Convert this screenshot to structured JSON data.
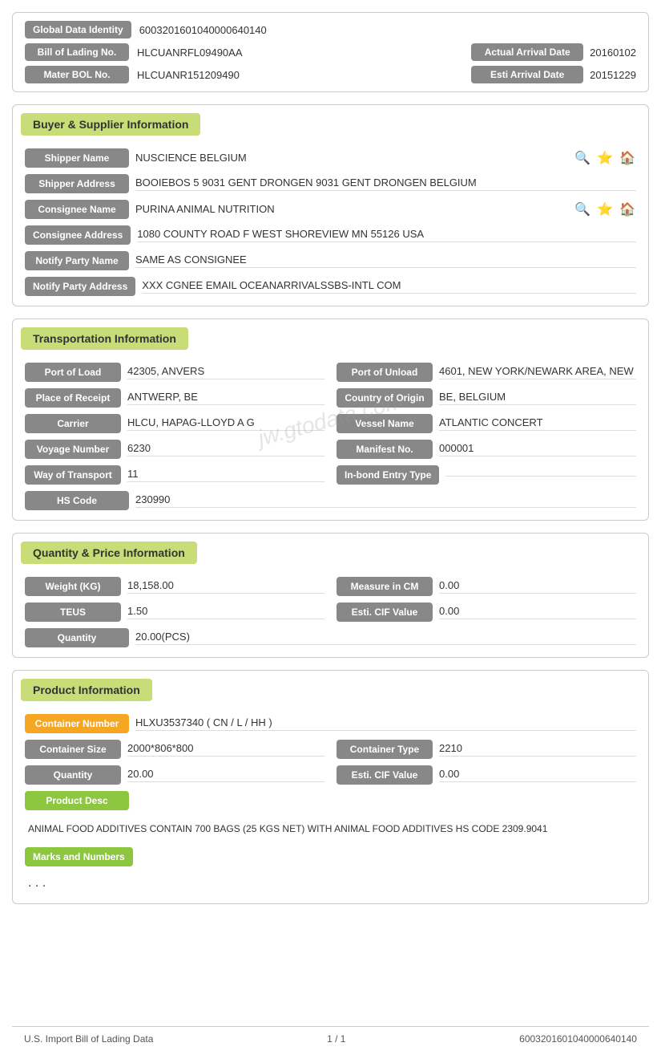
{
  "identity": {
    "global_data_label": "Global Data Identity",
    "global_data_value": "6003201601040000640140",
    "bol_label": "Bill of Lading No.",
    "bol_value": "HLCUANRFL09490AA",
    "actual_arrival_label": "Actual Arrival Date",
    "actual_arrival_value": "20160102",
    "master_bol_label": "Mater BOL No.",
    "master_bol_value": "HLCUANR151209490",
    "esti_arrival_label": "Esti Arrival Date",
    "esti_arrival_value": "20151229"
  },
  "buyer_supplier": {
    "section_title": "Buyer & Supplier Information",
    "shipper_name_label": "Shipper Name",
    "shipper_name_value": "NUSCIENCE BELGIUM",
    "shipper_address_label": "Shipper Address",
    "shipper_address_value": "BOOIEBOS 5 9031 GENT DRONGEN 9031 GENT DRONGEN BELGIUM",
    "consignee_name_label": "Consignee Name",
    "consignee_name_value": "PURINA ANIMAL NUTRITION",
    "consignee_address_label": "Consignee Address",
    "consignee_address_value": "1080 COUNTY ROAD F WEST SHOREVIEW MN 55126 USA",
    "notify_party_name_label": "Notify Party Name",
    "notify_party_name_value": "SAME AS CONSIGNEE",
    "notify_party_address_label": "Notify Party Address",
    "notify_party_address_value": "XXX CGNEE EMAIL OCEANARRIVALSSBS-INTL COM"
  },
  "transportation": {
    "section_title": "Transportation Information",
    "port_of_load_label": "Port of Load",
    "port_of_load_value": "42305, ANVERS",
    "port_of_unload_label": "Port of Unload",
    "port_of_unload_value": "4601, NEW YORK/NEWARK AREA, NEW",
    "place_of_receipt_label": "Place of Receipt",
    "place_of_receipt_value": "ANTWERP, BE",
    "country_of_origin_label": "Country of Origin",
    "country_of_origin_value": "BE, BELGIUM",
    "carrier_label": "Carrier",
    "carrier_value": "HLCU, HAPAG-LLOYD A G",
    "vessel_name_label": "Vessel Name",
    "vessel_name_value": "ATLANTIC CONCERT",
    "voyage_number_label": "Voyage Number",
    "voyage_number_value": "6230",
    "manifest_no_label": "Manifest No.",
    "manifest_no_value": "000001",
    "way_of_transport_label": "Way of Transport",
    "way_of_transport_value": "11",
    "in_bond_entry_label": "In-bond Entry Type",
    "in_bond_entry_value": "",
    "hs_code_label": "HS Code",
    "hs_code_value": "230990"
  },
  "quantity_price": {
    "section_title": "Quantity & Price Information",
    "weight_label": "Weight (KG)",
    "weight_value": "18,158.00",
    "measure_label": "Measure in CM",
    "measure_value": "0.00",
    "teus_label": "TEUS",
    "teus_value": "1.50",
    "esti_cif_label": "Esti. CIF Value",
    "esti_cif_value": "0.00",
    "quantity_label": "Quantity",
    "quantity_value": "20.00(PCS)"
  },
  "product_info": {
    "section_title": "Product Information",
    "container_number_label": "Container Number",
    "container_number_value": "HLXU3537340 ( CN / L / HH )",
    "container_size_label": "Container Size",
    "container_size_value": "2000*806*800",
    "container_type_label": "Container Type",
    "container_type_value": "2210",
    "quantity_label": "Quantity",
    "quantity_value": "20.00",
    "esti_cif_label": "Esti. CIF Value",
    "esti_cif_value": "0.00",
    "product_desc_label": "Product Desc",
    "product_desc_value": "ANIMAL FOOD ADDITIVES CONTAIN 700 BAGS (25 KGS NET) WITH ANIMAL FOOD ADDITIVES HS CODE 2309.9041",
    "marks_numbers_label": "Marks and Numbers",
    "marks_numbers_value": ". . ."
  },
  "footer": {
    "left": "U.S. Import Bill of Lading Data",
    "center": "1 / 1",
    "right": "6003201601040000640140"
  },
  "watermark": "jw.gtodata.com",
  "icons": {
    "search": "🔍",
    "star": "⭐",
    "home": "🏠"
  }
}
